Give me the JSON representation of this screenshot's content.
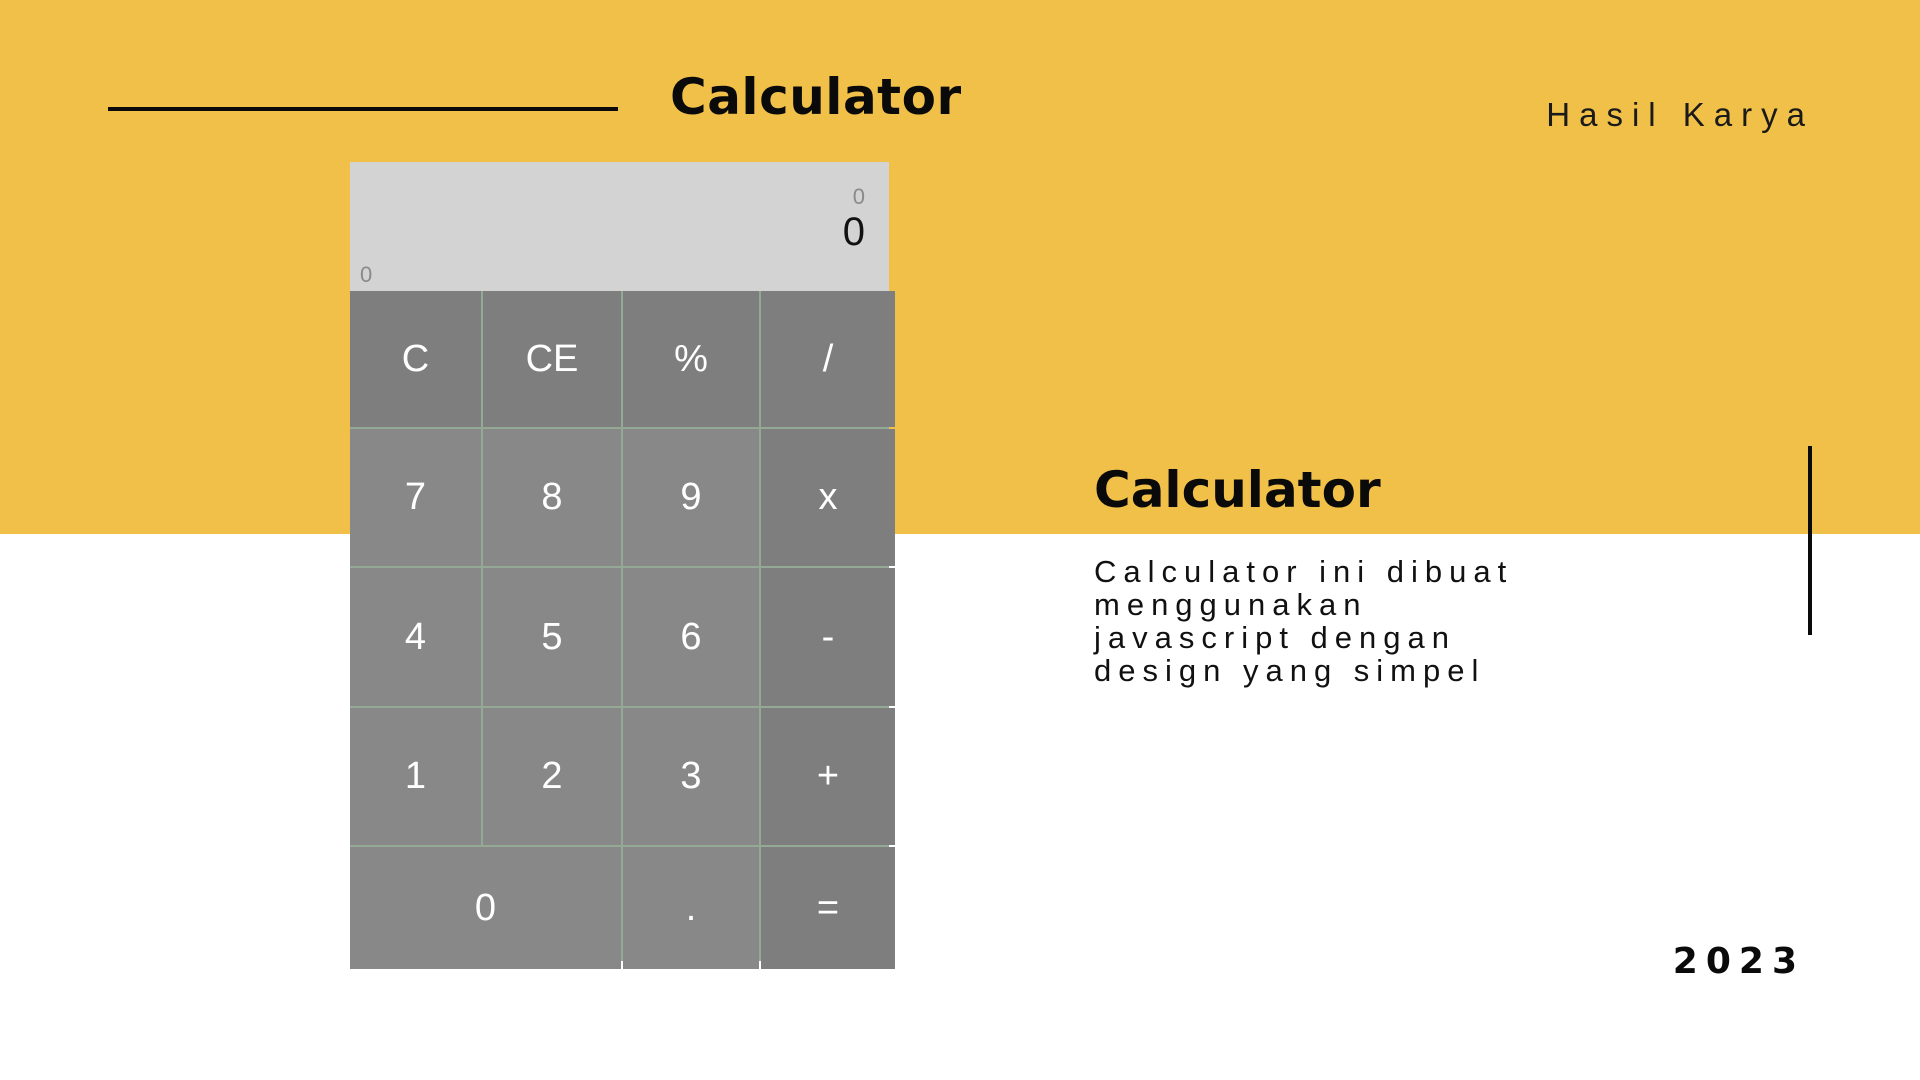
{
  "header": {
    "title": "Calculator",
    "subtitle": "Hasil Karya"
  },
  "calculator": {
    "display": {
      "previous": "0",
      "current": "0",
      "memory": "0"
    },
    "keys": [
      "C",
      "CE",
      "%",
      "/",
      "7",
      "8",
      "9",
      "x",
      "4",
      "5",
      "6",
      "-",
      "1",
      "2",
      "3",
      "+",
      "0",
      ".",
      "="
    ]
  },
  "section": {
    "title": "Calculator",
    "description": "Calculator ini dibuat\nmenggunakan\njavascript dengan\ndesign yang simpel"
  },
  "footer": {
    "year": "2023"
  },
  "colors": {
    "accent_yellow": "#F0C048",
    "calc_key_dark": "#7e7e7e",
    "calc_key_light": "#888888",
    "calc_display": "#d3d3d3",
    "grid_lines": "#93a895",
    "text_dark": "#0a0a0a"
  }
}
